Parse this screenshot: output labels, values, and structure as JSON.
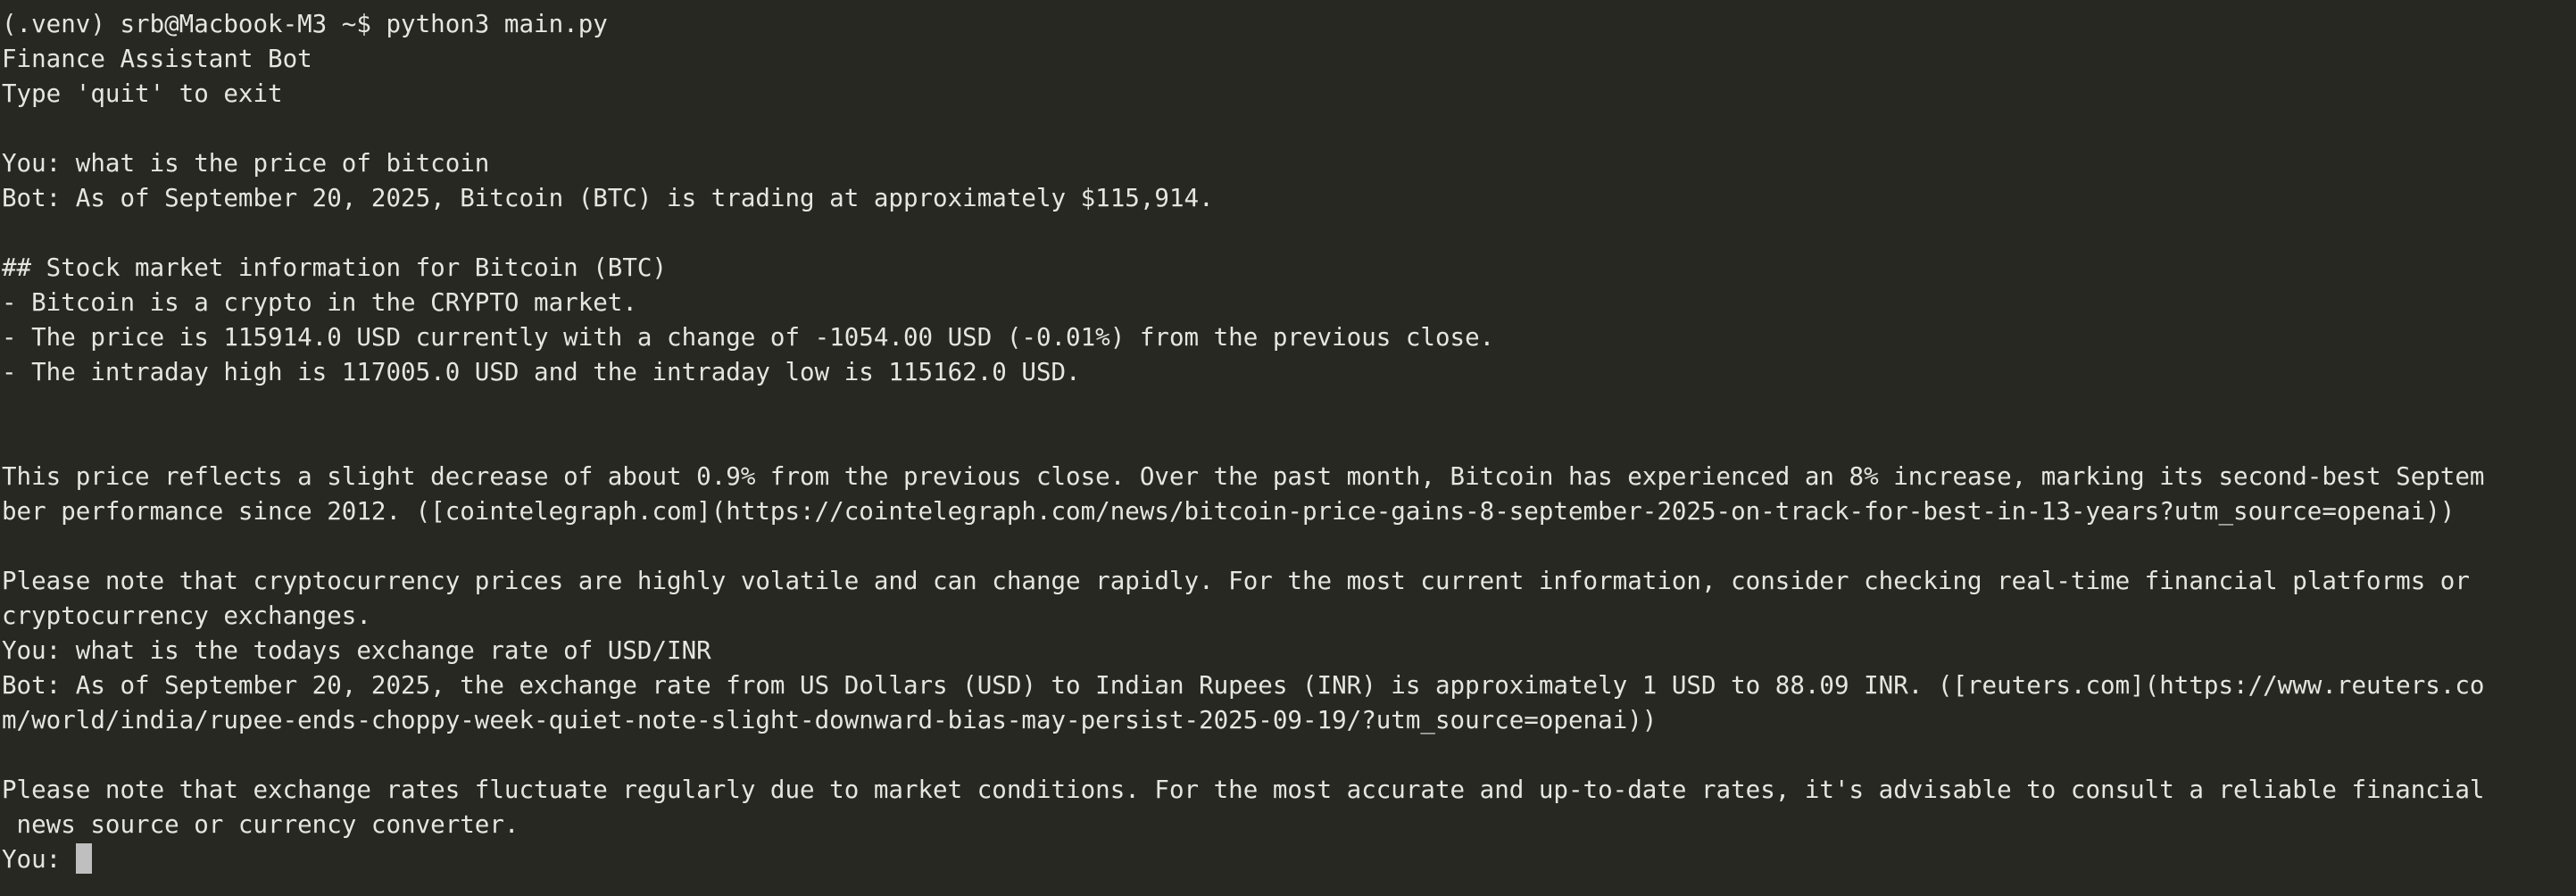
{
  "colors": {
    "background": "#272822",
    "foreground": "#e6e6e1",
    "cursor": "#bfbfbf"
  },
  "terminal": {
    "lines": [
      "(.venv) srb@Macbook-M3 ~$ python3 main.py",
      "Finance Assistant Bot",
      "Type 'quit' to exit",
      "",
      "You: what is the price of bitcoin",
      "Bot: As of September 20, 2025, Bitcoin (BTC) is trading at approximately $115,914.",
      "",
      "## Stock market information for Bitcoin (BTC)",
      "- Bitcoin is a crypto in the CRYPTO market.",
      "- The price is 115914.0 USD currently with a change of -1054.00 USD (-0.01%) from the previous close.",
      "- The intraday high is 117005.0 USD and the intraday low is 115162.0 USD.",
      "",
      "",
      "This price reflects a slight decrease of about 0.9% from the previous close. Over the past month, Bitcoin has experienced an 8% increase, marking its second-best Septem",
      "ber performance since 2012. ([cointelegraph.com](https://cointelegraph.com/news/bitcoin-price-gains-8-september-2025-on-track-for-best-in-13-years?utm_source=openai))",
      "",
      "Please note that cryptocurrency prices are highly volatile and can change rapidly. For the most current information, consider checking real-time financial platforms or",
      "cryptocurrency exchanges.",
      "You: what is the todays exchange rate of USD/INR",
      "Bot: As of September 20, 2025, the exchange rate from US Dollars (USD) to Indian Rupees (INR) is approximately 1 USD to 88.09 INR. ([reuters.com](https://www.reuters.co",
      "m/world/india/rupee-ends-choppy-week-quiet-note-slight-downward-bias-may-persist-2025-09-19/?utm_source=openai))",
      "",
      "Please note that exchange rates fluctuate regularly due to market conditions. For the most accurate and up-to-date rates, it's advisable to consult a reliable financial",
      " news source or currency converter."
    ],
    "prompt": "You: "
  }
}
